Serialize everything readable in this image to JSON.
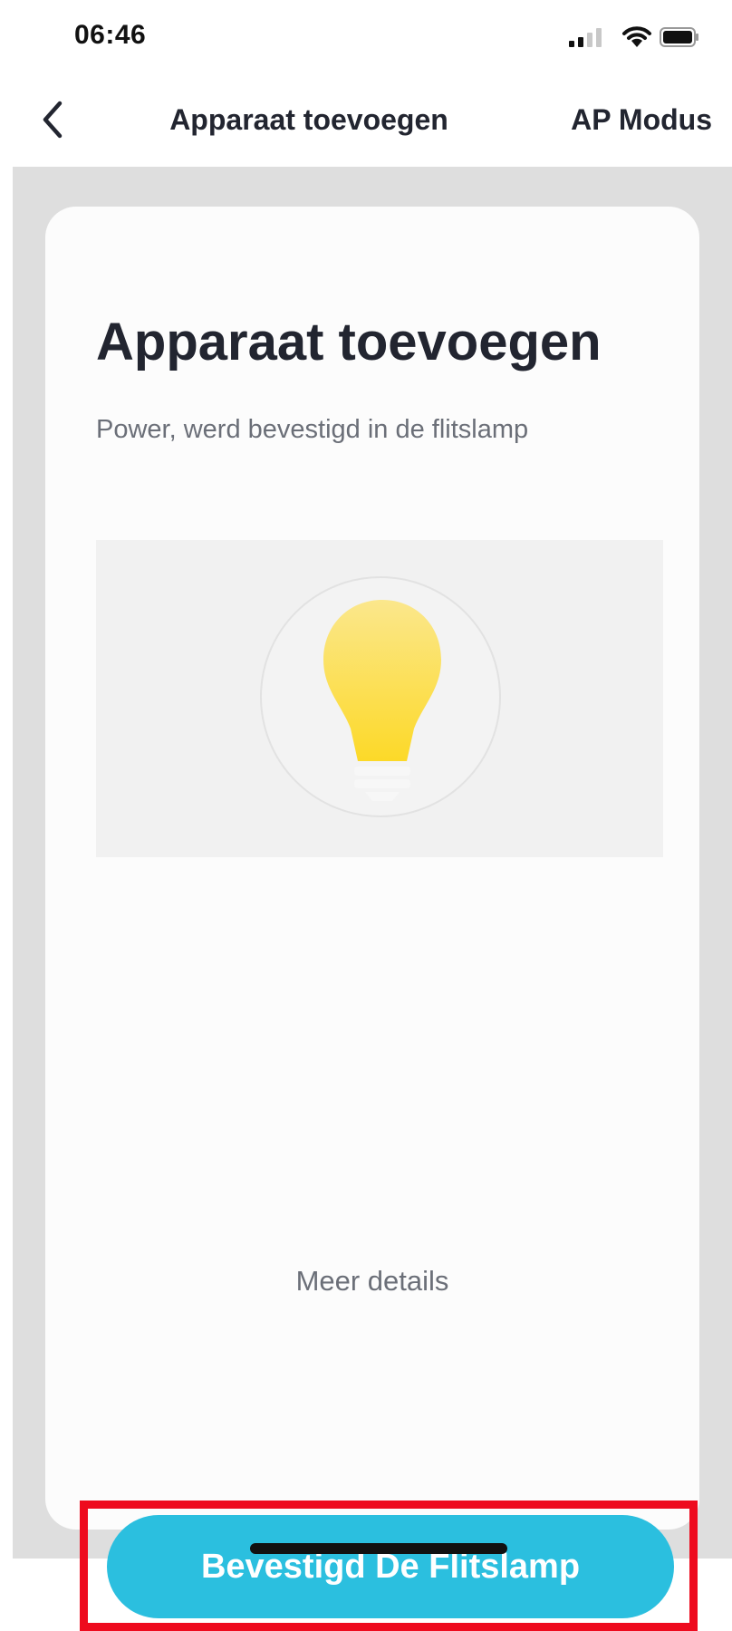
{
  "status_bar": {
    "time": "06:46"
  },
  "nav": {
    "title": "Apparaat toevoegen",
    "right_action": "AP Modus"
  },
  "card": {
    "title": "Apparaat toevoegen",
    "subtitle": "Power, werd bevestigd in de flitslamp",
    "illustration_icon": "light-bulb-icon",
    "more_details": "Meer details",
    "confirm_button": "Bevestigd De Flitslamp"
  },
  "colors": {
    "accent": "#2bbfdf",
    "highlight": "#ee0b1e",
    "background": "#dedede",
    "card": "#fcfcfc"
  }
}
